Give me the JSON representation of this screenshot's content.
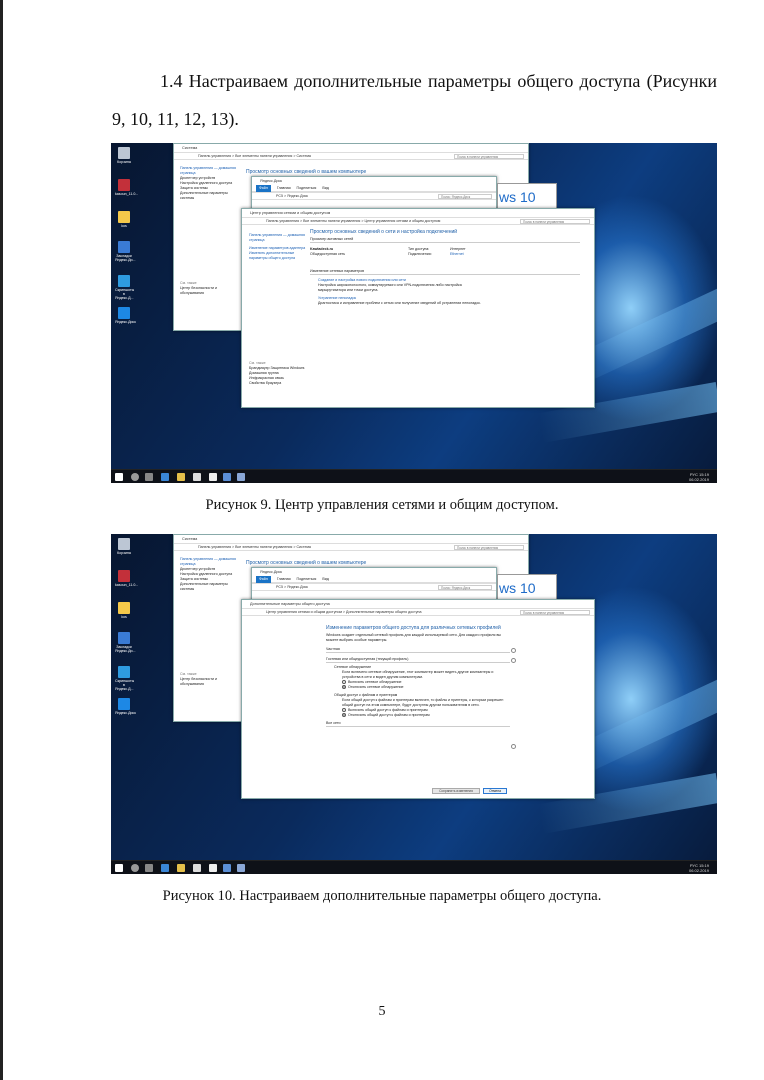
{
  "heading": {
    "line1": "1.4 Настраиваем дополнительные параметры общего доступа (Рисунки",
    "line2": "9, 10, 11, 12, 13)."
  },
  "figure9": {
    "caption": "Рисунок 9. Центр управления сетями и общим доступом.",
    "desktop_icons": [
      "Корзина",
      "kasoun_11.0...",
      "kos",
      "Закладки Яндекс.Ди...",
      "Скриншоты в Яндекс.Д...",
      "Яндекс.Диск"
    ],
    "system_window": {
      "title": "Система",
      "address": "Панель управления  >  Все элементы панели управления  >  Система",
      "search": "Поиск в панели управления",
      "side": [
        "Панель управления — домашняя страница",
        "Диспетчер устройств",
        "Настройка удаленного доступа",
        "Защита системы",
        "Дополнительные параметры системы"
      ],
      "heading": "Просмотр основных сведений о вашем компьютере",
      "see_also": "См. также",
      "see_also_item": "Центр безопасности и обслуживания"
    },
    "explorer_window": {
      "title": "Яндекс.Диск",
      "tabs": [
        "Файл",
        "Главная",
        "Поделиться",
        "Вид"
      ],
      "address": "PC5  >  Яндекс.Диск",
      "search": "Поиск: Яндекс.Диск"
    },
    "win10_text": "ws 10",
    "network_window": {
      "title": "Центр управления сетями и общим доступом",
      "address": "Панель управления  >  Все элементы панели управления  >  Центр управления сетями и общим доступом",
      "search": "Поиск в панели управления",
      "side": [
        "Панель управления — домашняя страница",
        "Изменение параметров адаптера",
        "Изменить дополнительные параметры общего доступа"
      ],
      "heading": "Просмотр основных сведений о сети и настройка подключений",
      "active_label": "Просмотр активных сетей",
      "net_name": "Kawladeck.ru",
      "net_type": "Общедоступная сеть",
      "access_label": "Тип доступа:",
      "access_value": "Интернет",
      "conn_label": "Подключения:",
      "conn_value": "Ethernet",
      "change_label": "Изменение сетевых параметров",
      "item1_title": "Создание и настройка нового подключения или сети",
      "item1_desc": "Настройка широкополосного, коммутируемого или VPN-подключения либо настройка маршрутизатора или точки доступа.",
      "item2_title": "Устранение неполадок",
      "item2_desc": "Диагностика и исправление проблем с сетью или получение сведений об устранении неполадок.",
      "see_also": "См. также",
      "see_also_items": [
        "Брандмауэр Защитника Windows",
        "Домашняя группа",
        "Инфракрасная связь",
        "Свойства браузера"
      ]
    },
    "tray": {
      "lang": "РУС",
      "time": "15:19",
      "date": "06.02.2019"
    }
  },
  "figure10": {
    "caption": "Рисунок 10. Настраиваем дополнительные параметры общего доступа.",
    "sharing_window": {
      "title": "Дополнительные параметры общего доступа",
      "address": "Центр управления сетями и общим доступом  >  Дополнительные параметры общего доступа",
      "search": "Поиск в панели управления",
      "heading": "Изменение параметров общего доступа для различных сетевых профилей",
      "intro": "Windows создает отдельный сетевой профиль для каждой используемой сети. Для каждого профиля вы можете выбрать особые параметры.",
      "private": "Частная",
      "guest": "Гостевая или общедоступная (текущий профиль)",
      "discovery_title": "Сетевое обнаружение",
      "discovery_desc": "Если включено сетевое обнаружение, этот компьютер может видеть другие компьютеры и устройства в сети и виден другим компьютерам.",
      "discovery_on": "Включить сетевое обнаружение",
      "discovery_off": "Отключить сетевое обнаружение",
      "sharing_title": "Общий доступ к файлам и принтерам",
      "sharing_desc": "Если общий доступ к файлам и принтерам включен, то файлы и принтеры, к которым разрешен общий доступ на этом компьютере, будут доступны другим пользователям в сети.",
      "sharing_on": "Включить общий доступ к файлам и принтерам",
      "sharing_off": "Отключить общий доступ к файлам и принтерам",
      "all_networks": "Все сети",
      "save": "Сохранить изменения",
      "cancel": "Отмена"
    }
  },
  "page_number": "5"
}
